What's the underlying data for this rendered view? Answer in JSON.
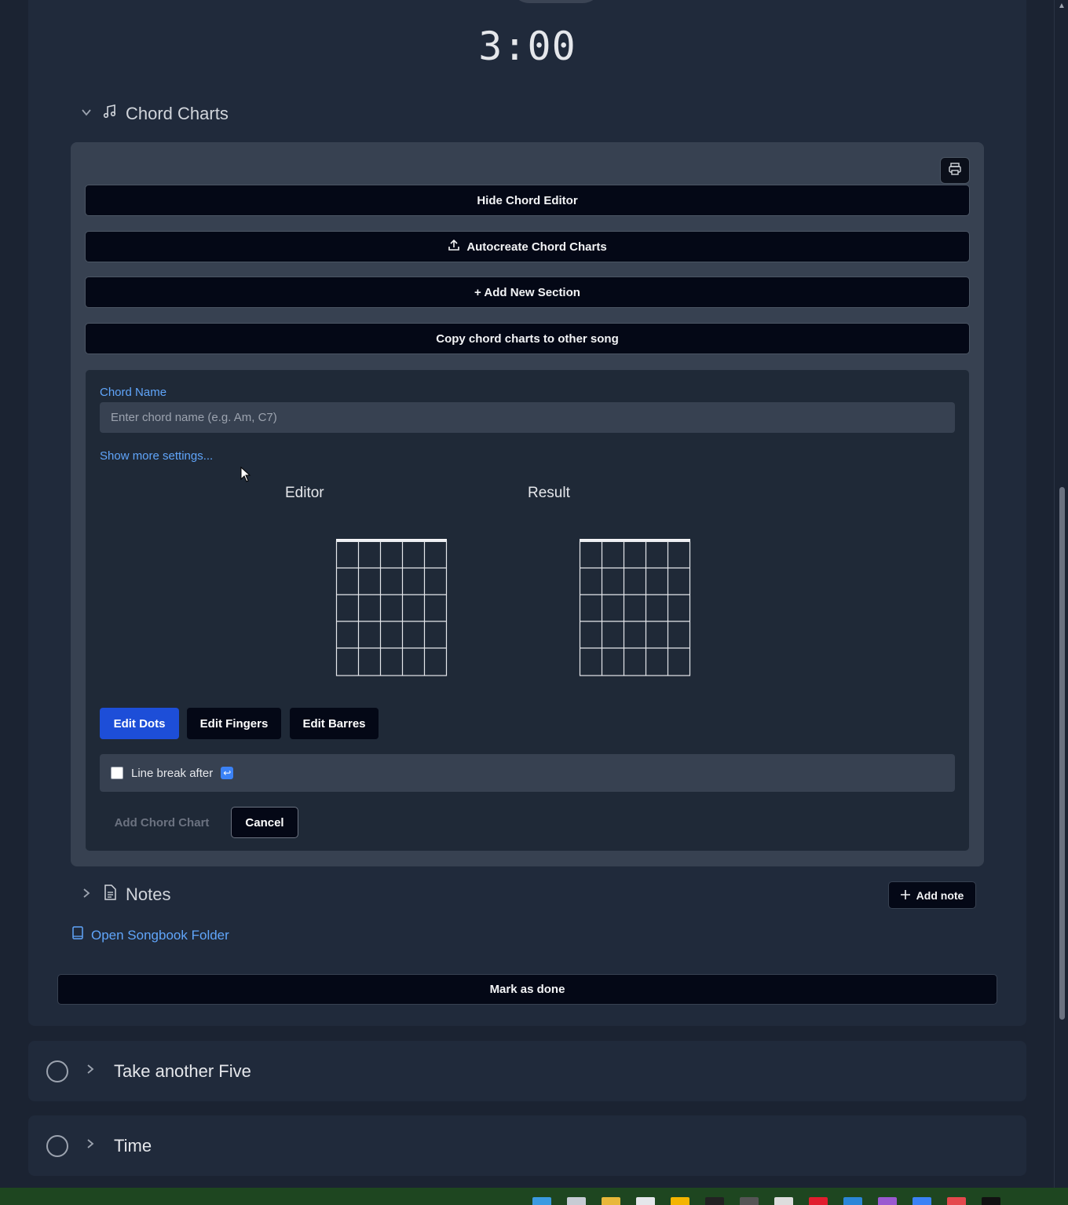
{
  "timer": {
    "value": "3:00"
  },
  "chord_charts": {
    "title": "Chord Charts",
    "buttons": {
      "hide_editor": "Hide Chord Editor",
      "autocreate": "Autocreate Chord Charts",
      "add_section": "+ Add New Section",
      "copy": "Copy chord charts to other song"
    },
    "editor": {
      "chord_name_label": "Chord Name",
      "chord_name_placeholder": "Enter chord name (e.g. Am, C7)",
      "show_more": "Show more settings...",
      "editor_title": "Editor",
      "result_title": "Result",
      "tabs": [
        "Edit Dots",
        "Edit Fingers",
        "Edit Barres"
      ],
      "active_tab": "Edit Dots",
      "line_break_label": "Line break after",
      "line_break_checked": false,
      "add_chord_chart": "Add Chord Chart",
      "cancel": "Cancel"
    }
  },
  "notes": {
    "title": "Notes",
    "add_note": "Add note"
  },
  "songbook_link": "Open Songbook Folder",
  "mark_done": "Mark as done",
  "items": [
    {
      "title": "Take another Five"
    },
    {
      "title": "Time"
    }
  ],
  "colors": {
    "background": "#1b2332",
    "card": "#202a3b",
    "panel": "#374151",
    "accent_blue": "#1d4ed8",
    "link_blue": "#60a5fa",
    "button_dark": "#040816"
  }
}
